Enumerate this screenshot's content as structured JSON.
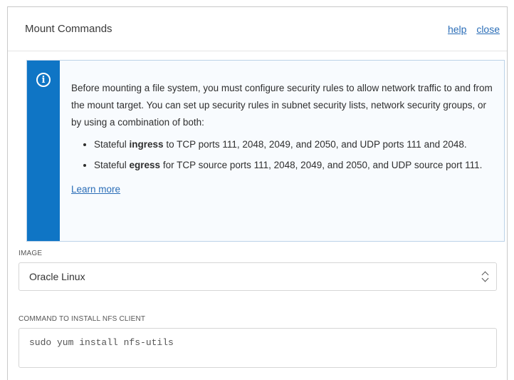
{
  "dialog": {
    "title": "Mount Commands",
    "help_label": "help",
    "close_label": "close"
  },
  "notice": {
    "icon": "info-icon",
    "accent_color": "#0f75c5",
    "intro": "Before mounting a file system, you must configure security rules to allow network traffic to and from the mount target. You can set up security rules in subnet security lists, network security groups, or by using a combination of both:",
    "bullets": [
      {
        "prefix": "Stateful ",
        "bold": "ingress",
        "suffix": " to TCP ports 111, 2048, 2049, and 2050, and UDP ports 111 and 2048."
      },
      {
        "prefix": "Stateful ",
        "bold": "egress",
        "suffix": " for TCP source ports 111, 2048, 2049, and 2050, and UDP source port 111."
      }
    ],
    "learn_more": "Learn more"
  },
  "image_field": {
    "label": "IMAGE",
    "selected": "Oracle Linux"
  },
  "install_field": {
    "label": "COMMAND TO INSTALL NFS CLIENT",
    "value": "sudo yum install nfs-utils"
  }
}
